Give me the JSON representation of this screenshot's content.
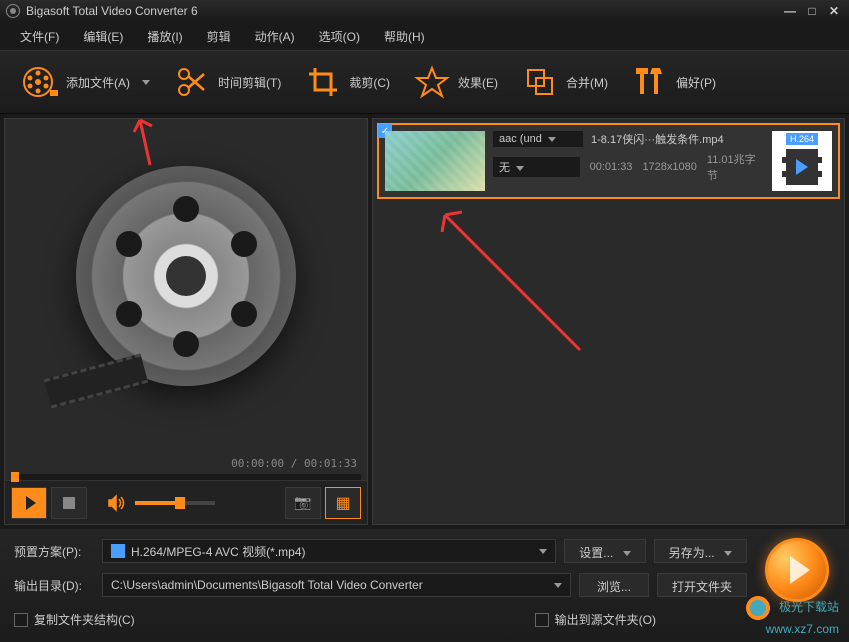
{
  "titlebar": {
    "title": "Bigasoft Total Video Converter 6"
  },
  "menubar": {
    "file": "文件(F)",
    "edit": "编辑(E)",
    "play": "播放(I)",
    "trim": "剪辑",
    "action": "动作(A)",
    "option": "选项(O)",
    "help": "帮助(H)"
  },
  "toolbar": {
    "add": "添加文件(A)",
    "trim": "时间剪辑(T)",
    "crop": "裁剪(C)",
    "effect": "效果(E)",
    "merge": "合并(M)",
    "pref": "偏好(P)"
  },
  "preview": {
    "time": "00:00:00 / 00:01:33"
  },
  "file": {
    "audio_codec": "aac (und",
    "subtitle": "无",
    "name": "1-8.17侠闪···触发条件.mp4",
    "duration": "00:01:33",
    "resolution": "1728x1080",
    "size": "11.01兆字节",
    "format": "H.264"
  },
  "bottom": {
    "preset_label": "预置方案(P):",
    "preset_value": "H.264/MPEG-4 AVC 视频(*.mp4)",
    "settings": "设置...",
    "saveas": "另存为...",
    "output_label": "输出目录(D):",
    "output_value": "C:\\Users\\admin\\Documents\\Bigasoft Total Video Converter",
    "browse": "浏览...",
    "open_folder": "打开文件夹",
    "copy_structure": "复制文件夹结构(C)",
    "output_source": "输出到源文件夹(O)"
  },
  "watermark": {
    "name": "极光下载站",
    "url": "www.xz7.com"
  }
}
